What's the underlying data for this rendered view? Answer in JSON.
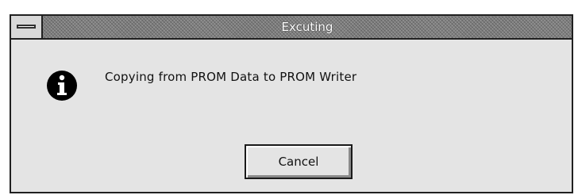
{
  "window": {
    "title": "Excuting"
  },
  "dialog": {
    "icon": "info-icon",
    "message": "Copying from PROM Data to PROM Writer",
    "cancel_label": "Cancel"
  },
  "colors": {
    "dialog_background": "#e4e4e4",
    "title_bar": "#808080",
    "icon_fill": "#000000"
  }
}
